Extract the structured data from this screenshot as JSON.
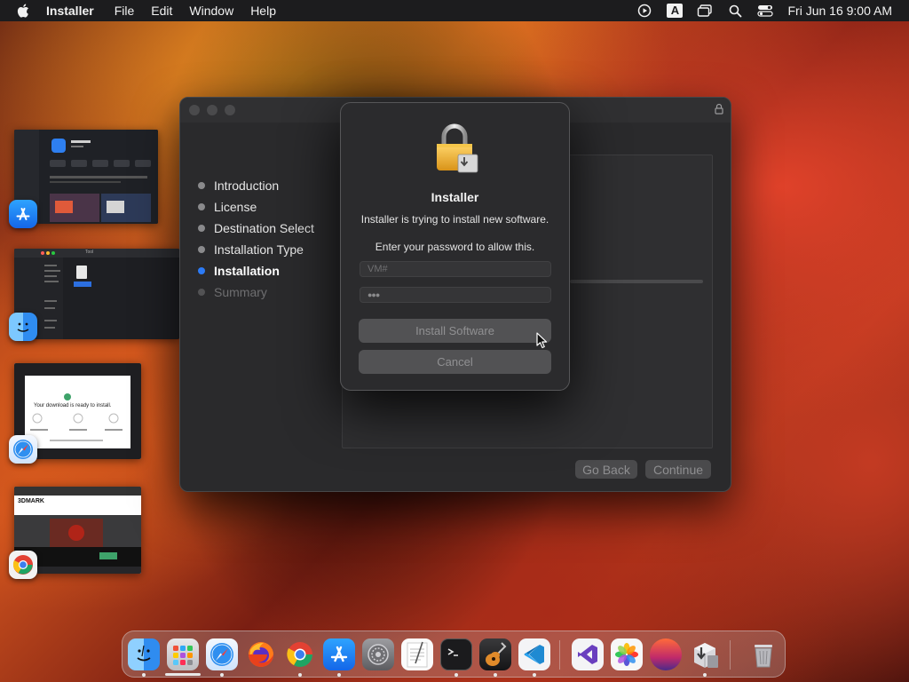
{
  "menubar": {
    "app_name": "Installer",
    "menus": [
      "File",
      "Edit",
      "Window",
      "Help"
    ],
    "input_source": "A",
    "clock": "Fri Jun 16  9:00 AM"
  },
  "installer_window": {
    "steps": [
      {
        "label": "Introduction",
        "state": "done"
      },
      {
        "label": "License",
        "state": "done"
      },
      {
        "label": "Destination Select",
        "state": "done"
      },
      {
        "label": "Installation Type",
        "state": "done"
      },
      {
        "label": "Installation",
        "state": "active"
      },
      {
        "label": "Summary",
        "state": "pending"
      }
    ],
    "go_back_label": "Go Back",
    "continue_label": "Continue"
  },
  "auth_dialog": {
    "title": "Installer",
    "message": "Installer is trying to install new software.",
    "prompt": "Enter your password to allow this.",
    "username_value": "VM#",
    "password_value": "●●●",
    "install_label": "Install Software",
    "cancel_label": "Cancel"
  },
  "thumbnails": {
    "finder_window_title": "Tool",
    "safari_page_heading": "Your download is ready to install.",
    "chrome_page_brand": "3DMARK"
  },
  "dock": {
    "apps": [
      "Finder",
      "Launchpad",
      "Safari",
      "Firefox",
      "Google Chrome",
      "App Store",
      "System Settings",
      "TextEdit",
      "Terminal",
      "GarageBand",
      "Visual Studio Code",
      "Visual Studio",
      "Photos",
      "macOS Ventura",
      "Installer",
      "Trash"
    ]
  },
  "colors": {
    "accent": "#2c7bf6",
    "menubar": "#1c1c1e",
    "window_bg": "#2a2a2c"
  }
}
